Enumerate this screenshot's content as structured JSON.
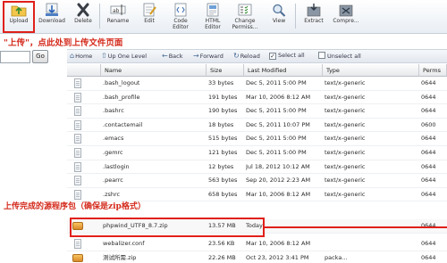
{
  "toolbar": {
    "buttons": [
      {
        "label": "Upload",
        "icon": "upload-icon"
      },
      {
        "label": "Download",
        "icon": "download-icon"
      },
      {
        "label": "Delete",
        "icon": "delete-icon"
      },
      {
        "label": "Rename",
        "icon": "rename-icon"
      },
      {
        "label": "Edit",
        "icon": "edit-icon"
      },
      {
        "label": "Code\nEditor",
        "icon": "code-editor-icon"
      },
      {
        "label": "HTML\nEditor",
        "icon": "html-editor-icon"
      },
      {
        "label": "Change\nPermiss...",
        "icon": "permissions-icon"
      },
      {
        "label": "View",
        "icon": "view-icon"
      },
      {
        "label": "Extract",
        "icon": "extract-icon"
      },
      {
        "label": "Compre...",
        "icon": "compress-icon"
      }
    ]
  },
  "annotations": {
    "upload_hint": "\"上传\"，点此处到上传文件页面",
    "zip_hint": "上传完成的源程序包（确保是zip格式）"
  },
  "left_panel": {
    "path_value": "",
    "go_label": "Go"
  },
  "nav": {
    "home": "Home",
    "up": "Up One Level",
    "back": "Back",
    "forward": "Forward",
    "reload": "Reload",
    "select_all": "Select all",
    "unselect_all": "Unselect all"
  },
  "table": {
    "headers": {
      "name": "Name",
      "size": "Size",
      "modified": "Last Modified",
      "type": "Type",
      "perms": "Perms"
    },
    "rows": [
      {
        "name": ".bash_logout",
        "size": "33 bytes",
        "modified": "Dec 5, 2011 5:00 PM",
        "type": "text/x-generic",
        "perms": "0644"
      },
      {
        "name": ".bash_profile",
        "size": "191 bytes",
        "modified": "Mar 10, 2006 8:12 AM",
        "type": "text/x-generic",
        "perms": "0644"
      },
      {
        "name": ".bashrc",
        "size": "190 bytes",
        "modified": "Dec 5, 2011 5:00 PM",
        "type": "text/x-generic",
        "perms": "0644"
      },
      {
        "name": ".contactemail",
        "size": "18 bytes",
        "modified": "Dec 5, 2011 10:07 PM",
        "type": "text/x-generic",
        "perms": "0600"
      },
      {
        "name": ".emacs",
        "size": "515 bytes",
        "modified": "Dec 5, 2011 5:00 PM",
        "type": "text/x-generic",
        "perms": "0644"
      },
      {
        "name": ".gemrc",
        "size": "121 bytes",
        "modified": "Dec 5, 2011 5:00 PM",
        "type": "text/x-generic",
        "perms": "0644"
      },
      {
        "name": ".lastlogin",
        "size": "12 bytes",
        "modified": "Jul 18, 2012 10:12 AM",
        "type": "text/x-generic",
        "perms": "0644"
      },
      {
        "name": ".pearrc",
        "size": "563 bytes",
        "modified": "Sep 20, 2012 2:23 AM",
        "type": "text/x-generic",
        "perms": "0644"
      },
      {
        "name": ".zshrc",
        "size": "658 bytes",
        "modified": "Mar 10, 2006 8:12 AM",
        "type": "text/x-generic",
        "perms": "0644"
      },
      {
        "name": "phpwind_UTF8_8.7.zip",
        "size": "13.57 MB",
        "modified": "Today",
        "type": "",
        "perms": "0644"
      },
      {
        "name": "webalizer.conf",
        "size": "23.56 KB",
        "modified": "Mar 10, 2006 8:12 AM",
        "type": "",
        "perms": "0644"
      },
      {
        "name": "测试所需.zip",
        "size": "22.26 MB",
        "modified": "Oct 23, 2012 3:41 PM",
        "type": "packa...",
        "perms": "0644"
      }
    ]
  },
  "colors": {
    "annotation_red": "#d42a1c",
    "highlight_red": "#e0201a"
  }
}
